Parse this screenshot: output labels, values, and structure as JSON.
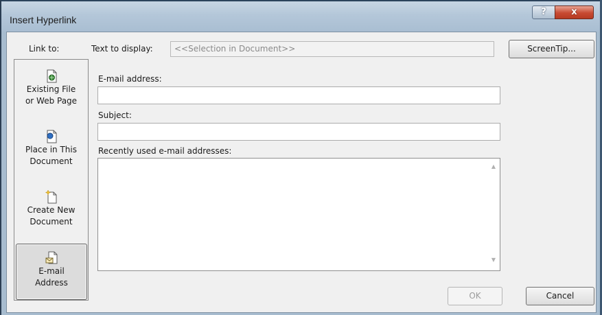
{
  "window": {
    "title": "Insert Hyperlink",
    "help_label": "?",
    "close_label": "x"
  },
  "link_to": {
    "label": "Link to:",
    "items": [
      {
        "line1": "Existing File",
        "line2": "or Web Page",
        "icon": "existing-file-icon",
        "selected": false
      },
      {
        "line1": "Place in This",
        "line2": "Document",
        "icon": "place-in-document-icon",
        "selected": false
      },
      {
        "line1": "Create New",
        "line2": "Document",
        "icon": "new-document-icon",
        "selected": false
      },
      {
        "line1": "E-mail",
        "line2": "Address",
        "icon": "email-address-icon",
        "selected": true
      }
    ]
  },
  "text_to_display": {
    "label": "Text to display:",
    "value": "<<Selection in Document>>"
  },
  "screentip_label": "ScreenTip...",
  "email": {
    "label": "E-mail address:",
    "value": ""
  },
  "subject": {
    "label": "Subject:",
    "value": ""
  },
  "recent": {
    "label": "Recently used e-mail addresses:",
    "items": []
  },
  "buttons": {
    "ok": "OK",
    "cancel": "Cancel"
  },
  "colors": {
    "title_bar": "#b4c7d9",
    "close_red": "#c74a32",
    "dialog_bg": "#f0f0f0"
  }
}
